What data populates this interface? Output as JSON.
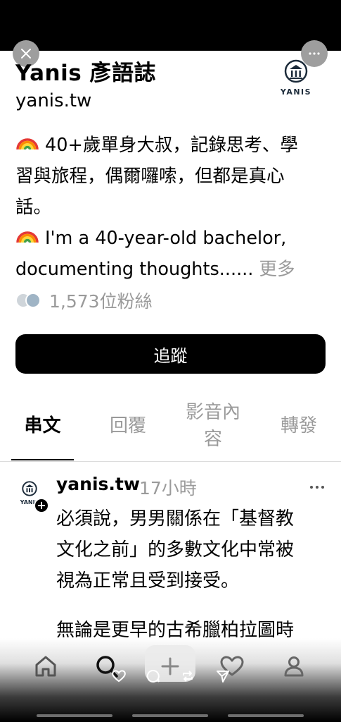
{
  "profile": {
    "name": "Yanis 彥語誌",
    "handle": "yanis.tw",
    "logo_text": "YANIS",
    "bio_lines": [
      "40+歲單身大叔，記錄思考、學",
      "習與旅程，偶爾囉嗦，但都是真心",
      "話。",
      "I'm a 40-year-old bachelor,",
      "documenting thoughts......"
    ],
    "bio_more": " 更多",
    "followers": "1,573位粉絲"
  },
  "follow_button": "追蹤",
  "tabs": [
    "串文",
    "回覆",
    "影音內容",
    "轉發"
  ],
  "tab_video_lines": [
    "影音內",
    "容"
  ],
  "post": {
    "avatar_text": "YANIS",
    "author": "yanis.tw",
    "time": "17小時",
    "body_lines": [
      "必須說，男男關係在「基督教",
      "文化之前」的多數文化中常被",
      "視為正常且受到接受。"
    ],
    "body_lines_2": [
      "無論是更早的古希臘柏拉圖時"
    ]
  },
  "icons": {
    "close": "close-icon",
    "more": "more-icon",
    "home": "home-icon",
    "search": "search-icon",
    "compose": "plus-icon",
    "activity": "heart-icon",
    "profile": "person-icon",
    "like": "heart-icon",
    "reply": "comment-icon",
    "repost": "repost-icon",
    "share": "send-icon"
  }
}
